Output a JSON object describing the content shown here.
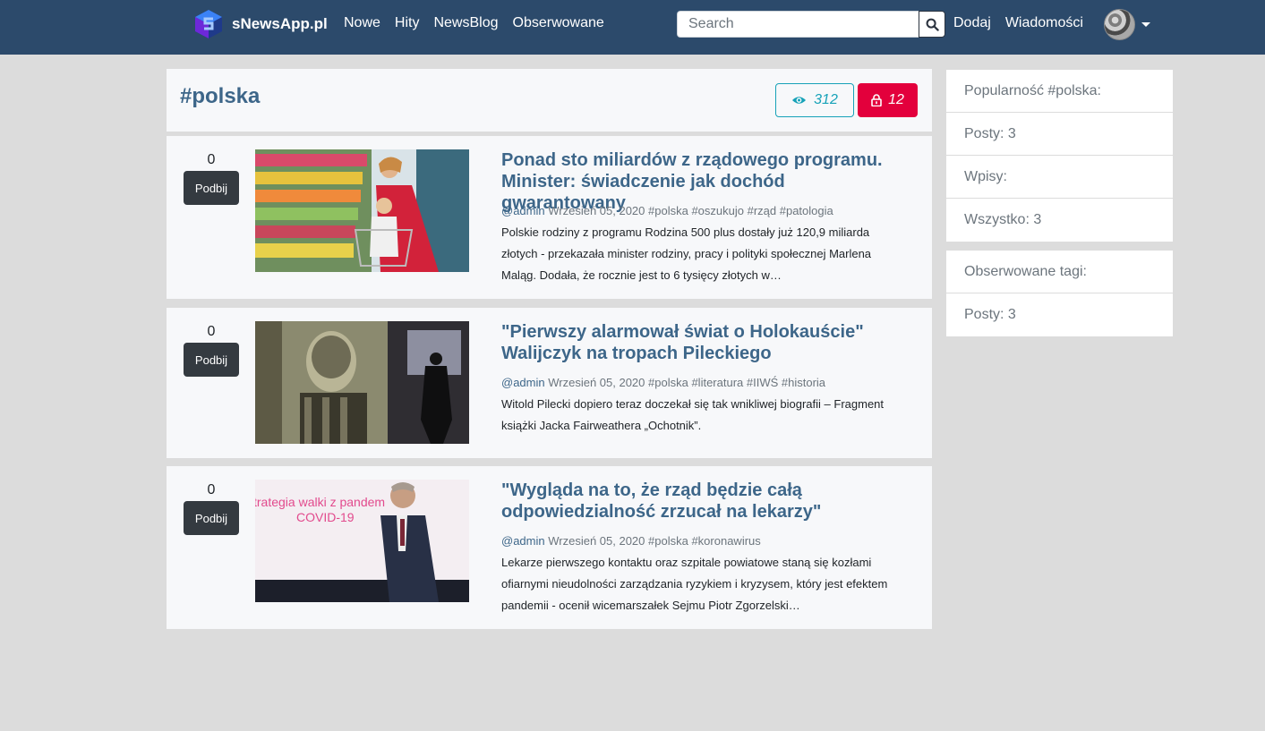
{
  "brand": {
    "name": "sNewsApp.pl",
    "logo_icon": "hexagon-s-logo-icon"
  },
  "nav": {
    "links": [
      "Nowe",
      "Hity",
      "NewsBlog",
      "Obserwowane"
    ],
    "right": [
      "Dodaj",
      "Wiadomości"
    ]
  },
  "search": {
    "placeholder": "Search",
    "value": ""
  },
  "tag": {
    "title": "#polska",
    "views": "312",
    "locked": "12"
  },
  "colors": {
    "navbar": "#2c4a6b",
    "link": "#3d6689",
    "views": "#17a2b8",
    "lock": "#e3003c",
    "vote_button": "#343a40"
  },
  "posts": [
    {
      "votes": "0",
      "vote_label": "Podbij",
      "title": "Ponad sto miliardów z rządowego programu. Minister: świadczenie jak dochód gwarantowany",
      "author": "@admin",
      "date": "Wrzesień 05, 2020",
      "tags": "#polska #oszukujo #rząd #patologia",
      "excerpt": "Polskie rodziny z programu Rodzina 500 plus dostały już 120,9 miliarda złotych - przekazała minister rodziny, pracy i polityki społecznej Marlena Maląg. Dodała, że rocznie jest to 6 tysięcy złotych w…"
    },
    {
      "votes": "0",
      "vote_label": "Podbij",
      "title": "\"Pierwszy alarmował świat o Holokauście\" Walijczyk na tropach Pileckiego",
      "author": "@admin",
      "date": "Wrzesień 05, 2020",
      "tags": "#polska #literatura #IIWŚ #historia",
      "excerpt": "Witold Pilecki dopiero teraz doczekał się tak wnikliwej biografii – Fragment książki Jacka Fairweathera „Ochotnik”."
    },
    {
      "votes": "0",
      "vote_label": "Podbij",
      "title": "\"Wygląda na to, że rząd będzie całą odpowiedzialność zrzucał na lekarzy\"",
      "author": "@admin",
      "date": "Wrzesień 05, 2020",
      "tags": "#polska #koronawirus",
      "excerpt": "Lekarze pierwszego kontaktu oraz szpitale powiatowe staną się kozłami ofiarnymi nieudolności zarządzania ryzykiem i kryzysem, który jest efektem pandemii - ocenił wicemarszałek Sejmu Piotr Zgorzelski…",
      "image_text": [
        "trategia walki z pandem",
        "COVID-19"
      ]
    }
  ],
  "sidebar": {
    "popularity": [
      "Popularność #polska:",
      "Posty: 3",
      "Wpisy:",
      "Wszystko: 3"
    ],
    "followed": [
      "Obserwowane tagi:",
      "Posty: 3"
    ]
  }
}
